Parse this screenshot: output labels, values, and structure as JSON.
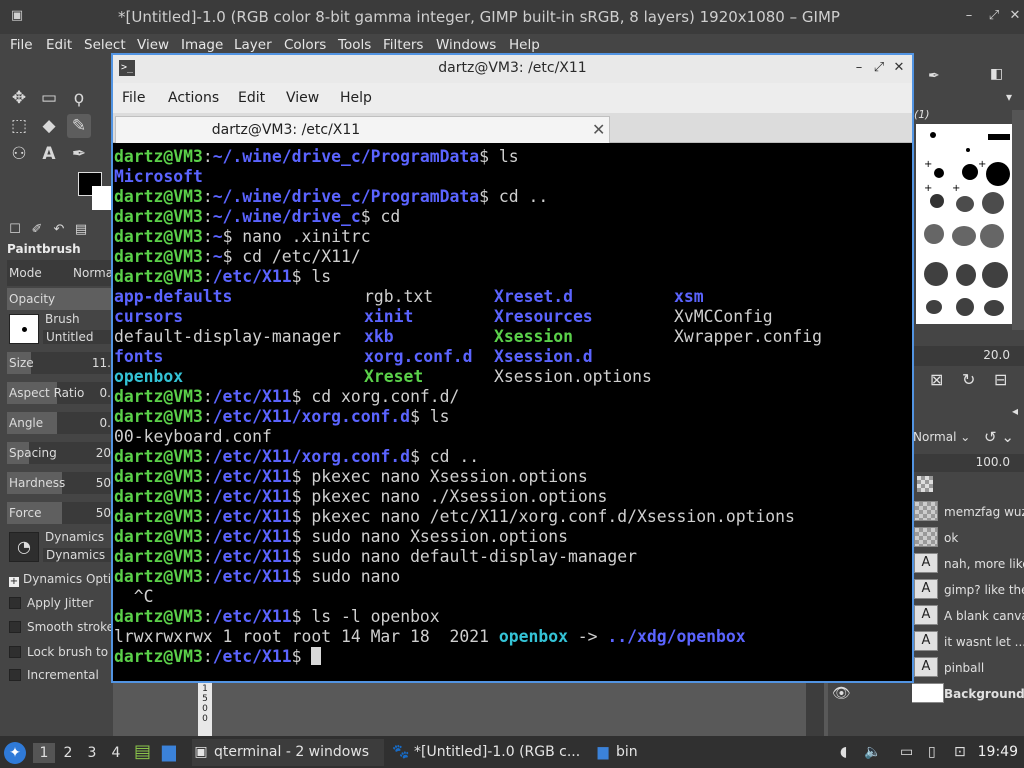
{
  "gimp": {
    "title": "*[Untitled]-1.0 (RGB color 8-bit gamma integer, GIMP built-in sRGB, 8 layers) 1920x1080 – GIMP",
    "menu": [
      "File",
      "Edit",
      "Select",
      "View",
      "Image",
      "Layer",
      "Colors",
      "Tools",
      "Filters",
      "Windows",
      "Help"
    ],
    "tool_options": {
      "title": "Paintbrush",
      "mode_label": "Mode",
      "mode_value": "Norma",
      "opacity_label": "Opacity",
      "brush_label": "Brush",
      "brush_value": "Untitled",
      "size_label": "Size",
      "size_value": "11.",
      "aspect_label": "Aspect Ratio",
      "aspect_value": "0.",
      "angle_label": "Angle",
      "angle_value": "0.",
      "spacing_label": "Spacing",
      "spacing_value": "20",
      "hardness_label": "Hardness",
      "hardness_value": "50",
      "force_label": "Force",
      "force_value": "50",
      "dynamics_label": "Dynamics",
      "dynamics_value": "Dynamics",
      "dynamics_options": "Dynamics Opti",
      "apply_jitter": "Apply Jitter",
      "smooth_stroke": "Smooth stroke",
      "lock_brush": "Lock brush to v",
      "incremental": "Incremental"
    },
    "dock": {
      "brush_preset": "(1)",
      "spacing_value": "20.0",
      "mode_value": "Normal",
      "opacity_value": "100.0",
      "layers": [
        {
          "name": "memzfag wuz",
          "type": "image"
        },
        {
          "name": "ok",
          "type": "image"
        },
        {
          "name": "nah, more like",
          "type": "text"
        },
        {
          "name": "gimp? like the",
          "type": "text"
        },
        {
          "name": "A blank canva",
          "type": "text"
        },
        {
          "name": "it wasnt let ...",
          "type": "text"
        },
        {
          "name": "pinball",
          "type": "text"
        },
        {
          "name": "Background",
          "type": "background"
        }
      ]
    },
    "ruler_text": "1\n5\n0\n0"
  },
  "terminal": {
    "title": "dartz@VM3: /etc/X11",
    "menu": [
      "File",
      "Actions",
      "Edit",
      "View",
      "Help"
    ],
    "tab_label": "dartz@VM3: /etc/X11",
    "user": "dartz@VM3",
    "lines": [
      {
        "path": "~/.wine/drive_c/ProgramData",
        "cmd": " ls"
      },
      {
        "out": "Microsoft",
        "cls": "dir"
      },
      {
        "path": "~/.wine/drive_c/ProgramData",
        "cmd": " cd .."
      },
      {
        "path": "~/.wine/drive_c",
        "cmd": " cd"
      },
      {
        "path": "~",
        "cmd": " nano .xinitrc"
      },
      {
        "path": "~",
        "cmd": " cd /etc/X11/"
      },
      {
        "path": "/etc/X11",
        "cmd": " ls"
      },
      {
        "grid": [
          [
            {
              "t": "app-defaults",
              "c": "dir"
            },
            {
              "t": "rgb.txt",
              "c": "c"
            },
            {
              "t": "Xreset.d",
              "c": "dir"
            },
            {
              "t": "xsm",
              "c": "dir"
            }
          ]
        ]
      },
      {
        "grid": [
          [
            {
              "t": "cursors",
              "c": "dir"
            },
            {
              "t": "xinit",
              "c": "dir"
            },
            {
              "t": "Xresources",
              "c": "dir"
            },
            {
              "t": "XvMCConfig",
              "c": "c"
            }
          ]
        ]
      },
      {
        "grid": [
          [
            {
              "t": "default-display-manager",
              "c": "c"
            },
            {
              "t": "xkb",
              "c": "dir"
            },
            {
              "t": "Xsession",
              "c": "exe"
            },
            {
              "t": "Xwrapper.config",
              "c": "c"
            }
          ]
        ]
      },
      {
        "grid": [
          [
            {
              "t": "fonts",
              "c": "dir"
            },
            {
              "t": "xorg.conf.d",
              "c": "dir"
            },
            {
              "t": "Xsession.d",
              "c": "dir"
            },
            {
              "t": "",
              "c": "c"
            }
          ]
        ]
      },
      {
        "grid": [
          [
            {
              "t": "openbox",
              "c": "lnk"
            },
            {
              "t": "Xreset",
              "c": "exe"
            },
            {
              "t": "Xsession.options",
              "c": "c"
            },
            {
              "t": "",
              "c": "c"
            }
          ]
        ]
      },
      {
        "path": "/etc/X11",
        "cmd": " cd xorg.conf.d/"
      },
      {
        "path": "/etc/X11/xorg.conf.d",
        "cmd": " ls"
      },
      {
        "out": "00-keyboard.conf",
        "cls": "c"
      },
      {
        "path": "/etc/X11/xorg.conf.d",
        "cmd": " cd .."
      },
      {
        "path": "/etc/X11",
        "cmd": " pkexec nano Xsession.options"
      },
      {
        "path": "/etc/X11",
        "cmd": " pkexec nano ./Xsession.options"
      },
      {
        "path": "/etc/X11",
        "cmd": " pkexec nano /etc/X11/xorg.conf.d/Xsession.options"
      },
      {
        "path": "/etc/X11",
        "cmd": " sudo nano Xsession.options"
      },
      {
        "path": "/etc/X11",
        "cmd": " sudo nano default-display-manager"
      },
      {
        "path": "/etc/X11",
        "cmd": " sudo nano"
      },
      {
        "out": "  ^C",
        "cls": "c"
      },
      {
        "path": "/etc/X11",
        "cmd": " ls -l openbox"
      },
      {
        "link": {
          "pre": "lrwxrwxrwx 1 root root 14 Mar 18  2021 ",
          "name": "openbox",
          "arrow": " -> ",
          "target": "../xdg/openbox"
        }
      },
      {
        "path": "/etc/X11",
        "cmd": " ",
        "cursor": true
      }
    ]
  },
  "taskbar": {
    "workspaces": [
      "1",
      "2",
      "3",
      "4"
    ],
    "tasks": [
      {
        "label": "qterminal - 2 windows",
        "icon": "terminal-icon"
      },
      {
        "label": "*[Untitled]-1.0 (RGB c...",
        "icon": "gimp-icon"
      },
      {
        "label": "bin",
        "icon": "folder-icon"
      }
    ],
    "clock": "19:49"
  }
}
